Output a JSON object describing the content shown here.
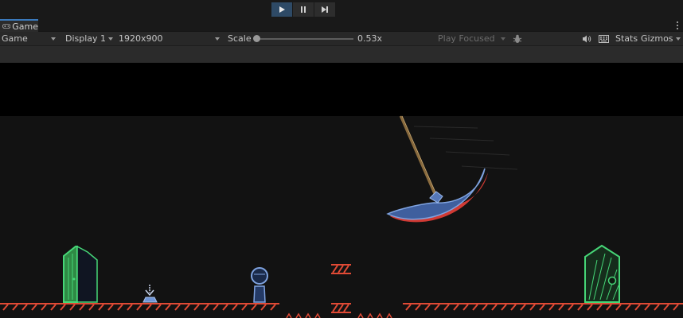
{
  "toolbar": {
    "play_icon": "play-icon",
    "pause_icon": "pause-icon",
    "step_icon": "step-icon"
  },
  "tab": {
    "label": "Game",
    "icon": "gamepad-icon"
  },
  "game_toolbar": {
    "view_mode": "Game",
    "display": "Display 1",
    "resolution": "1920x900",
    "scale_label": "Scale",
    "scale_value": "0.53x",
    "play_mode": "Play Focused",
    "stats": "Stats",
    "gizmos": "Gizmos"
  },
  "colors": {
    "accent": "#3a79bb",
    "ground": "#d93b2b",
    "door_green": "#3ec46d",
    "character_blue": "#6f95d6"
  }
}
